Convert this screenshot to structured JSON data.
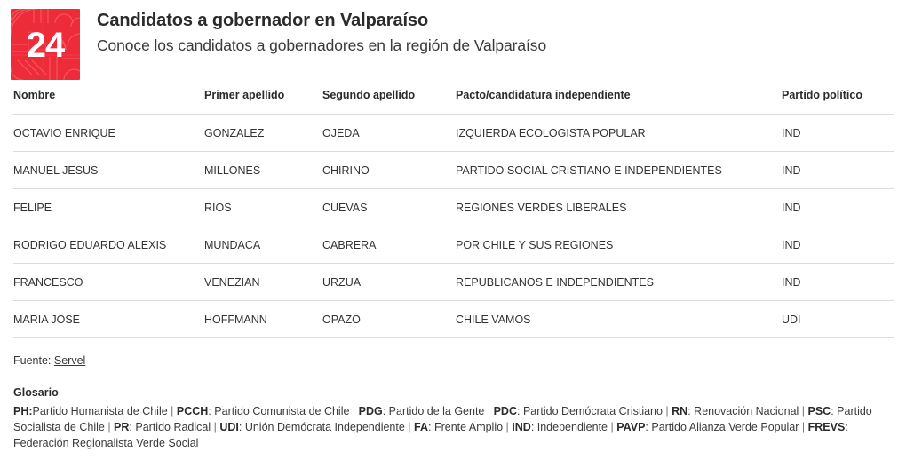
{
  "header": {
    "logo_text": "24",
    "logo_color": "#ee2b38",
    "title": "Candidatos a gobernador en Valparaíso",
    "subtitle": "Conoce los candidatos a gobernadores en la región de Valparaíso"
  },
  "table": {
    "columns": [
      "Nombre",
      "Primer apellido",
      "Segundo apellido",
      "Pacto/candidatura independiente",
      "Partido político"
    ],
    "rows": [
      {
        "nombre": "OCTAVIO ENRIQUE",
        "primer_apellido": "GONZALEZ",
        "segundo_apellido": "OJEDA",
        "pacto": "IZQUIERDA ECOLOGISTA POPULAR",
        "partido": "IND"
      },
      {
        "nombre": "MANUEL JESUS",
        "primer_apellido": "MILLONES",
        "segundo_apellido": "CHIRINO",
        "pacto": "PARTIDO SOCIAL CRISTIANO E INDEPENDIENTES",
        "partido": "IND"
      },
      {
        "nombre": "FELIPE",
        "primer_apellido": "RIOS",
        "segundo_apellido": "CUEVAS",
        "pacto": "REGIONES VERDES LIBERALES",
        "partido": "IND"
      },
      {
        "nombre": "RODRIGO EDUARDO ALEXIS",
        "primer_apellido": "MUNDACA",
        "segundo_apellido": "CABRERA",
        "pacto": "POR CHILE Y SUS REGIONES",
        "partido": "IND"
      },
      {
        "nombre": "FRANCESCO",
        "primer_apellido": "VENEZIAN",
        "segundo_apellido": "URZUA",
        "pacto": "REPUBLICANOS E INDEPENDIENTES",
        "partido": "IND"
      },
      {
        "nombre": "MARIA JOSE",
        "primer_apellido": "HOFFMANN",
        "segundo_apellido": "OPAZO",
        "pacto": "CHILE VAMOS",
        "partido": "UDI"
      }
    ]
  },
  "footer": {
    "source_label": "Fuente:",
    "source_link": "Servel",
    "glossary_title": "Glosario",
    "glossary_entries": [
      {
        "abbr": "PH:",
        "text": "Partido Humanista de Chile"
      },
      {
        "abbr": "PCCH",
        "text": ": Partido Comunista de Chile"
      },
      {
        "abbr": "PDG",
        "text": ": Partido de la Gente"
      },
      {
        "abbr": "PDC",
        "text": ": Partido Demócrata Cristiano"
      },
      {
        "abbr": "RN",
        "text": ": Renovación Nacional"
      },
      {
        "abbr": "PSC",
        "text": ": Partido Socialista de Chile"
      },
      {
        "abbr": "PR",
        "text": ": Partido Radical"
      },
      {
        "abbr": "UDI",
        "text": ": Unión Demócrata Independiente"
      },
      {
        "abbr": "FA",
        "text": ": Frente Amplio"
      },
      {
        "abbr": "IND",
        "text": ": Independiente"
      },
      {
        "abbr": "PAVP",
        "text": ": Partido Alianza Verde Popular"
      },
      {
        "abbr": "FREVS",
        "text": ": Federación Regionalista Verde Social"
      }
    ],
    "separator": "|"
  }
}
